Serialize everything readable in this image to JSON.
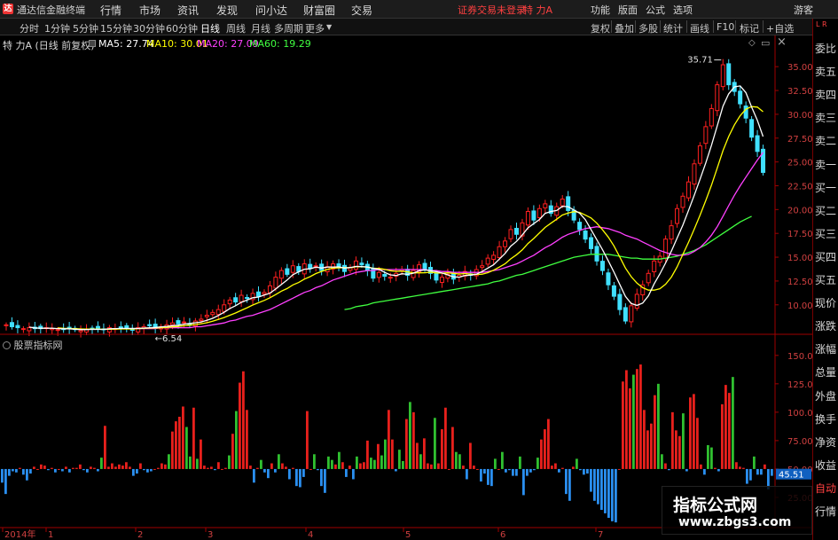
{
  "titlebar": {
    "app_name": "通达信金融终端",
    "menus": [
      "行情",
      "市场",
      "资讯",
      "发现",
      "问小达",
      "财富圈",
      "交易"
    ],
    "login_status": "证券交易未登录",
    "stock_name": "特 力A",
    "right_menus": [
      "功能",
      "版面",
      "公式",
      "选项"
    ],
    "guest": "游客"
  },
  "toolbar": {
    "periods": [
      "分时",
      "1分钟",
      "5分钟",
      "15分钟",
      "30分钟",
      "60分钟",
      "日线",
      "周线",
      "月线",
      "多周期",
      "更多"
    ],
    "active_period": "日线",
    "right_buttons": [
      "复权",
      "叠加",
      "多股",
      "统计",
      "画线",
      "F10",
      "标记",
      "+自选"
    ]
  },
  "chart_header": {
    "title": "特 力A (日线 前复权)",
    "ma": [
      {
        "label": "MA5: 27.74",
        "color": "#ffffff"
      },
      {
        "label": "MA10: 30.01",
        "color": "#ffff00"
      },
      {
        "label": "MA20: 27.09",
        "color": "#ff40ff"
      },
      {
        "label": "MA60: 19.29",
        "color": "#40ff40"
      }
    ]
  },
  "side_panel": {
    "corner": [
      "L",
      "R"
    ],
    "items": [
      "委比",
      "卖五",
      "卖四",
      "卖三",
      "卖二",
      "卖一",
      "买一",
      "买二",
      "买三",
      "买四",
      "买五",
      "现价",
      "涨跌",
      "涨幅",
      "总量",
      "外盘",
      "换手",
      "净资",
      "收益",
      "自动",
      "行情"
    ]
  },
  "indicator": {
    "name": "股票指标网",
    "current_value": "45.51"
  },
  "date_axis": [
    "2014年",
    "1",
    "2",
    "3",
    "4",
    "5",
    "6",
    "7"
  ],
  "watermark": {
    "title": "指标公式网",
    "url": "www.zbgs3.com"
  },
  "colors": {
    "up": "#ff2020",
    "down": "#40e0ff",
    "ma5": "#ffffff",
    "ma10": "#ffff00",
    "ma20": "#ff40ff",
    "ma60": "#40ff40",
    "bar_red": "#e8201c",
    "bar_green": "#30c030",
    "bar_blue": "#2a8ff0",
    "axis": "#a00000"
  },
  "chart_data": [
    {
      "type": "candlestick",
      "title": "特 力A (日线 前复权)",
      "y_ticks": [
        10.0,
        12.5,
        15.0,
        17.5,
        20.0,
        22.5,
        25.0,
        27.5,
        30.0,
        32.5,
        35.0
      ],
      "ylim": [
        7.0,
        36.6
      ],
      "annotations": [
        {
          "label": "35.71",
          "value": 35.71
        },
        {
          "label": "6.54",
          "value": 6.54
        }
      ],
      "series": [
        {
          "name": "MA5",
          "value": 27.74
        },
        {
          "name": "MA10",
          "value": 30.01
        },
        {
          "name": "MA20",
          "value": 27.09
        },
        {
          "name": "MA60",
          "value": 19.29
        }
      ],
      "close": [
        7.9,
        7.7,
        7.6,
        7.5,
        7.6,
        7.5,
        7.5,
        7.6,
        7.5,
        7.4,
        7.4,
        7.5,
        7.4,
        7.3,
        7.4,
        7.5,
        7.5,
        7.4,
        7.6,
        7.5,
        7.6,
        7.5,
        7.4,
        7.6,
        7.7,
        7.8,
        7.6,
        7.7,
        7.9,
        8.1,
        8.0,
        8.2,
        8.0,
        8.3,
        8.5,
        8.9,
        9.2,
        9.5,
        10.0,
        10.5,
        10.3,
        11.0,
        10.7,
        11.2,
        10.9,
        11.3,
        12.0,
        12.9,
        13.6,
        13.2,
        14.1,
        13.5,
        14.3,
        13.8,
        14.1,
        13.6,
        14.0,
        14.3,
        13.9,
        13.5,
        13.9,
        14.6,
        14.2,
        13.6,
        12.8,
        13.4,
        13.0,
        12.9,
        13.3,
        13.7,
        13.1,
        13.6,
        14.2,
        13.7,
        13.3,
        12.6,
        12.9,
        13.2,
        12.7,
        13.1,
        13.5,
        13.1,
        13.7,
        14.1,
        14.9,
        15.2,
        16.1,
        16.7,
        17.9,
        17.4,
        18.6,
        19.8,
        18.9,
        20.1,
        20.6,
        19.6,
        20.3,
        21.1,
        19.9,
        18.9,
        17.9,
        16.9,
        15.9,
        14.6,
        13.6,
        12.1,
        10.9,
        9.5,
        8.3,
        9.9,
        11.1,
        12.1,
        13.3,
        14.6,
        15.1,
        16.9,
        18.3,
        20.1,
        21.4,
        22.9,
        24.8,
        26.7,
        28.7,
        30.6,
        33.1,
        35.2,
        33.1,
        32.4,
        31.1,
        29.6,
        27.6,
        26.1,
        23.9
      ],
      "ma20": [
        null,
        null,
        null,
        null,
        null,
        null,
        null,
        null,
        null,
        null,
        null,
        null,
        null,
        null,
        null,
        null,
        null,
        null,
        null,
        7.5,
        7.5,
        7.5,
        7.5,
        7.5,
        7.5,
        7.5,
        7.5,
        7.6,
        7.6,
        7.6,
        7.6,
        7.6,
        7.6,
        7.7,
        7.7,
        7.8,
        7.9,
        8.0,
        8.1,
        8.3,
        8.4,
        8.6,
        8.8,
        8.9,
        9.1,
        9.3,
        9.5,
        9.8,
        10.1,
        10.4,
        10.7,
        11.0,
        11.3,
        11.5,
        11.8,
        12.0,
        12.3,
        12.6,
        12.8,
        13.0,
        13.2,
        13.4,
        13.5,
        13.6,
        13.6,
        13.7,
        13.7,
        13.7,
        13.7,
        13.7,
        13.7,
        13.7,
        13.7,
        13.7,
        13.6,
        13.6,
        13.5,
        13.5,
        13.4,
        13.4,
        13.4,
        13.4,
        13.4,
        13.4,
        13.5,
        13.6,
        13.7,
        13.9,
        14.1,
        14.3,
        14.6,
        14.9,
        15.2,
        15.6,
        16.0,
        16.3,
        16.7,
        17.1,
        17.4,
        17.6,
        17.8,
        18.0,
        18.1,
        18.2,
        18.1,
        18.0,
        17.8,
        17.6,
        17.3,
        17.1,
        16.9,
        16.6,
        16.3,
        16.0,
        15.7,
        15.5,
        15.3,
        15.2,
        15.2,
        15.3,
        15.6,
        16.0,
        16.6,
        17.3,
        18.2,
        19.3,
        20.4,
        21.5,
        22.5,
        23.4,
        24.3,
        25.2,
        26.0
      ],
      "ma60": [
        null,
        null,
        null,
        null,
        null,
        null,
        null,
        null,
        null,
        null,
        null,
        null,
        null,
        null,
        null,
        null,
        null,
        null,
        null,
        null,
        null,
        null,
        null,
        null,
        null,
        null,
        null,
        null,
        null,
        null,
        null,
        null,
        null,
        null,
        null,
        null,
        null,
        null,
        null,
        null,
        null,
        null,
        null,
        null,
        null,
        null,
        null,
        null,
        null,
        null,
        null,
        null,
        null,
        null,
        null,
        null,
        null,
        null,
        null,
        9.5,
        9.6,
        9.8,
        9.9,
        10.0,
        10.2,
        10.3,
        10.4,
        10.5,
        10.6,
        10.7,
        10.8,
        10.9,
        11.0,
        11.1,
        11.2,
        11.3,
        11.4,
        11.5,
        11.6,
        11.7,
        11.8,
        11.9,
        12.0,
        12.1,
        12.2,
        12.4,
        12.5,
        12.7,
        12.9,
        13.1,
        13.2,
        13.4,
        13.6,
        13.8,
        14.0,
        14.2,
        14.4,
        14.6,
        14.8,
        15.0,
        15.1,
        15.2,
        15.3,
        15.3,
        15.3,
        15.3,
        15.2,
        15.1,
        15.0,
        14.9,
        14.9,
        14.8,
        14.8,
        14.8,
        14.8,
        14.9,
        15.0,
        15.1,
        15.3,
        15.5,
        15.7,
        16.0,
        16.3,
        16.7,
        17.1,
        17.5,
        17.9,
        18.3,
        18.7,
        19.0,
        19.3
      ]
    },
    {
      "type": "bar",
      "title": "股票指标网",
      "y_ticks": [
        25.0,
        50.0,
        75.0,
        100.0,
        125.0,
        150.0
      ],
      "ylim": [
        0,
        160
      ],
      "baseline": 50,
      "current_value": 45.51,
      "values": [
        38,
        28,
        44,
        48,
        47,
        51,
        45,
        40,
        46,
        52,
        50,
        54,
        53,
        49,
        51,
        47,
        50,
        48,
        52,
        47,
        51,
        51,
        54,
        49,
        47,
        52,
        51,
        48,
        60,
        88,
        52,
        55,
        52,
        54,
        53,
        56,
        52,
        44,
        46,
        55,
        49,
        47,
        48,
        50,
        51,
        55,
        54,
        63,
        83,
        92,
        96,
        105,
        87,
        61,
        104,
        59,
        76,
        53,
        51,
        52,
        49,
        56,
        50,
        51,
        62,
        81,
        101,
        126,
        136,
        102,
        53,
        38,
        51,
        58,
        47,
        42,
        55,
        47,
        63,
        55,
        52,
        41,
        51,
        35,
        34,
        43,
        101,
        50,
        63,
        49,
        35,
        29,
        61,
        58,
        54,
        65,
        56,
        43,
        53,
        41,
        61,
        55,
        56,
        75,
        60,
        58,
        72,
        62,
        76,
        102,
        76,
        48,
        67,
        57,
        94,
        109,
        100,
        73,
        63,
        77,
        55,
        54,
        95,
        55,
        85,
        104,
        50,
        87,
        65,
        63,
        53,
        41,
        73,
        53,
        50,
        39,
        46,
        36,
        35,
        59,
        50,
        65,
        47,
        49,
        44,
        44,
        61,
        27,
        44,
        47,
        49,
        60,
        76,
        85,
        94,
        53,
        55,
        47,
        51,
        28,
        22,
        52,
        59,
        49,
        45,
        46,
        30,
        22,
        19,
        14,
        11,
        7,
        4,
        3,
        50,
        127,
        137,
        121,
        133,
        138,
        142,
        102,
        84,
        90,
        115,
        125,
        63,
        55,
        49,
        100,
        84,
        79,
        99,
        48,
        113,
        116,
        95,
        54,
        45,
        71,
        69,
        51,
        48,
        107,
        124,
        117,
        131,
        56,
        52,
        51,
        37,
        40,
        61,
        45,
        45,
        54,
        32,
        44
      ],
      "colors_note": "red above baseline with large values, green above baseline small values, blue below baseline"
    }
  ]
}
